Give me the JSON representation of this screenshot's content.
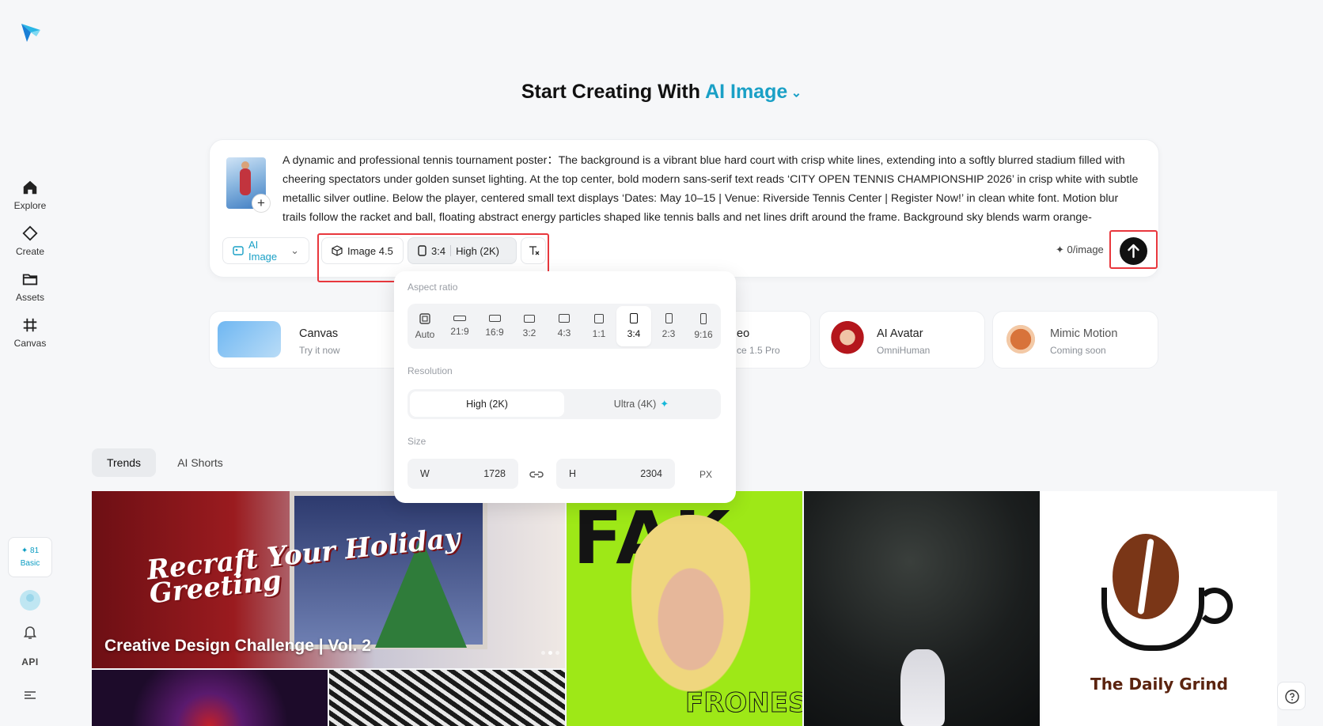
{
  "sidebar": {
    "items": [
      {
        "label": "Explore",
        "icon": "home-icon"
      },
      {
        "label": "Create",
        "icon": "diamond-icon"
      },
      {
        "label": "Assets",
        "icon": "folder-icon"
      },
      {
        "label": "Canvas",
        "icon": "canvas-icon"
      }
    ],
    "credits": "81",
    "plan": "Basic",
    "api": "API"
  },
  "heading": {
    "prefix": "Start Creating With",
    "mode": "AI Image"
  },
  "prompt": {
    "text": "A dynamic and professional tennis tournament poster：The background is a vibrant blue hard court with crisp white lines, extending into a softly blurred stadium filled with cheering spectators under golden sunset lighting. At the top center, bold modern sans-serif text reads ‘CITY OPEN TENNIS CHAMPIONSHIP 2026’ in crisp white with subtle metallic silver outline. Below the player, centered small text displays ‘Dates: May 10–15 | Venue: Riverside Tennis Center | Register Now!’ in clean white font. Motion blur trails follow the racket and ball, floating abstract energy particles shaped like tennis balls and net lines drift around the frame. Background sky blends warm orange-",
    "add": "+"
  },
  "toolbar": {
    "mode": "AI Image",
    "model": "Image 4.5",
    "ratio": "3:4",
    "resolution": "High (2K)",
    "cost": "0/image"
  },
  "quick_cards": [
    {
      "title": "Canvas",
      "sub": "Try it now"
    },
    {
      "title": "eo",
      "sub": "ce 1.5 Pro"
    },
    {
      "title": "AI Avatar",
      "sub": "OmniHuman"
    },
    {
      "title": "Mimic Motion",
      "sub": "Coming soon"
    }
  ],
  "tabs": [
    "Trends",
    "AI Shorts"
  ],
  "gallery": {
    "featured_script": "Recraft Your Holiday Greeting",
    "featured_caption": "Creative Design Challenge | Vol. 2",
    "poster_top": "FAK",
    "poster_bottom": "FRONES",
    "logo_name": "The Daily Grind"
  },
  "popover": {
    "aspect_label": "Aspect ratio",
    "ratios": [
      "Auto",
      "21:9",
      "16:9",
      "3:2",
      "4:3",
      "1:1",
      "3:4",
      "2:3",
      "9:16"
    ],
    "selected_ratio": "3:4",
    "resolution_label": "Resolution",
    "resolutions": [
      "High (2K)",
      "Ultra (4K)"
    ],
    "size_label": "Size",
    "width_label": "W",
    "width": "1728",
    "height_label": "H",
    "height": "2304",
    "unit": "PX"
  },
  "colors": {
    "accent": "#1aa0c6",
    "highlight": "#e8373d"
  }
}
